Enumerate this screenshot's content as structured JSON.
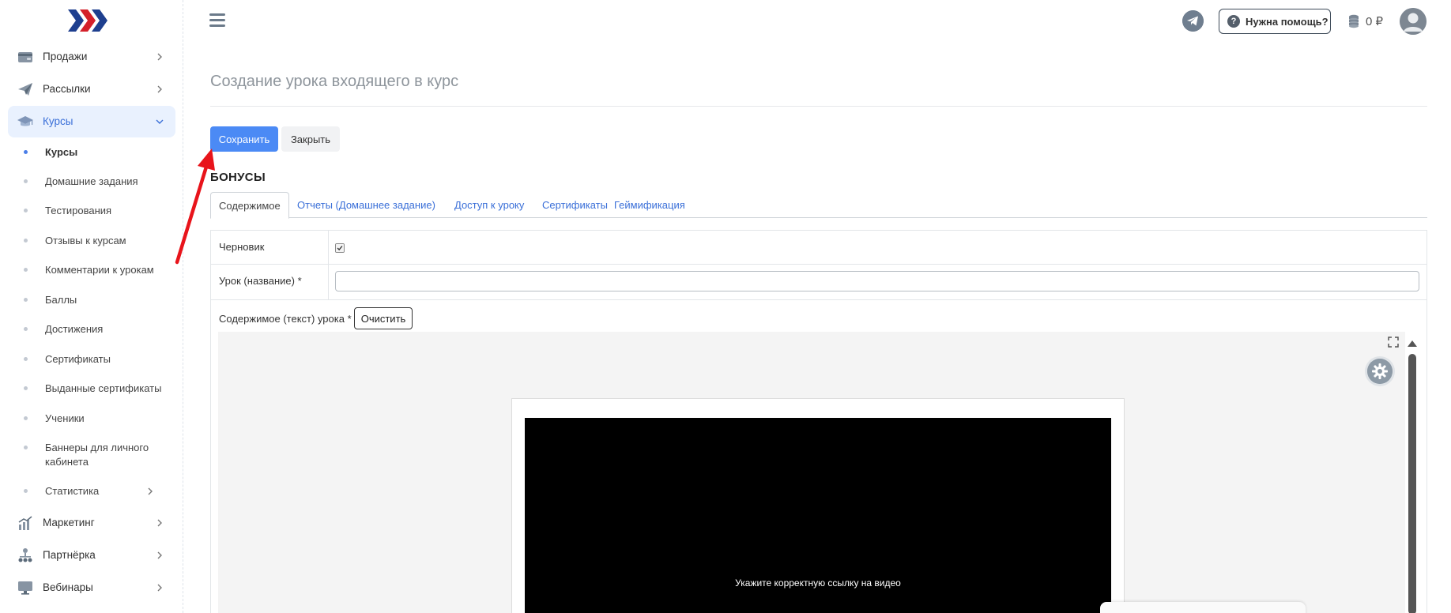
{
  "sidebar": {
    "items": [
      {
        "label": "Продажи",
        "icon": "wallet-icon"
      },
      {
        "label": "Рассылки",
        "icon": "paper-plane-icon"
      },
      {
        "label": "Курсы",
        "icon": "graduation-cap-icon",
        "active": true
      },
      {
        "label": "Маркетинг",
        "icon": "bar-chart-icon"
      },
      {
        "label": "Партнёрка",
        "icon": "network-icon"
      },
      {
        "label": "Вебинары",
        "icon": "monitor-icon"
      }
    ],
    "subitems": [
      {
        "label": "Курсы",
        "active": true
      },
      {
        "label": "Домашние задания"
      },
      {
        "label": "Тестирования"
      },
      {
        "label": "Отзывы к курсам"
      },
      {
        "label": "Комментарии к урокам"
      },
      {
        "label": "Баллы"
      },
      {
        "label": "Достижения"
      },
      {
        "label": "Сертификаты"
      },
      {
        "label": "Выданные сертификаты"
      },
      {
        "label": "Ученики"
      },
      {
        "label": "Баннеры для личного кабинета"
      },
      {
        "label": "Статистика",
        "has_children": true
      }
    ]
  },
  "header": {
    "help_label": "Нужна помощь?",
    "help_icon_glyph": "?",
    "balance": "0 ₽"
  },
  "page": {
    "title": "Создание урока входящего в курс",
    "save_label": "Сохранить",
    "close_label": "Закрыть",
    "section_title": "БОНУСЫ"
  },
  "tabs": [
    {
      "label": "Содержимое",
      "active": true
    },
    {
      "label": "Отчеты (Домашнее задание)"
    },
    {
      "label": "Доступ к уроку"
    },
    {
      "label": "Сертификаты"
    },
    {
      "label": "Геймификация"
    }
  ],
  "form": {
    "draft_label": "Черновик",
    "draft_checked": true,
    "lesson_name_label": "Урок (название) *",
    "lesson_name_value": "",
    "content_label": "Содержимое (текст) урока *",
    "clear_label": "Очистить",
    "video_message": "Укажите корректную ссылку на видео"
  },
  "colors": {
    "primary": "#4b8af5",
    "link": "#3a6fd8",
    "active_bg": "#e9f1fe",
    "annotation_arrow": "#e8141b"
  }
}
